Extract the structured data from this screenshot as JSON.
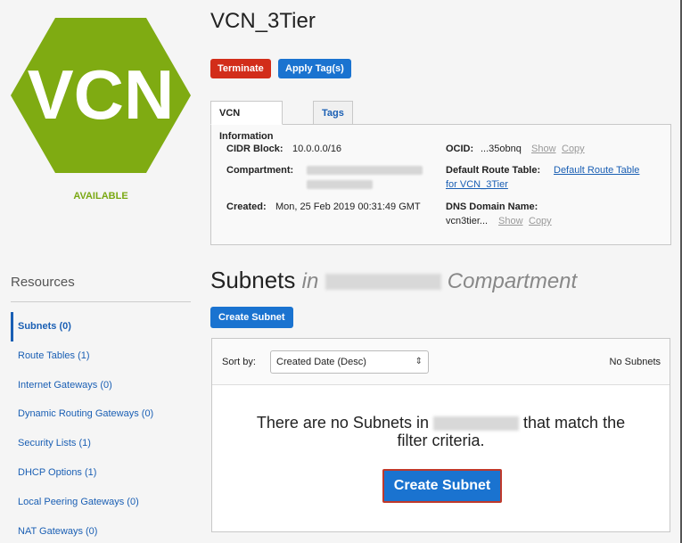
{
  "vcn": {
    "badge_text": "VCN",
    "status": "AVAILABLE",
    "title": "VCN_3Tier"
  },
  "actions": {
    "terminate": "Terminate",
    "apply_tags": "Apply Tag(s)"
  },
  "tabs": [
    {
      "label": "VCN Information"
    },
    {
      "label": "Tags"
    }
  ],
  "info": {
    "cidr_label": "CIDR Block:",
    "cidr_value": "10.0.0.0/16",
    "compartment_label": "Compartment:",
    "created_label": "Created:",
    "created_value": "Mon, 25 Feb 2019 00:31:49 GMT",
    "ocid_label": "OCID:",
    "ocid_value": "...35obnq",
    "show": "Show",
    "copy": "Copy",
    "route_table_label": "Default Route Table:",
    "route_table_value_1": "Default Route Table",
    "route_table_value_2": "for VCN_3Tier",
    "dns_label": "DNS Domain Name:",
    "dns_value": "vcn3tier..."
  },
  "resources": {
    "heading": "Resources",
    "items": [
      {
        "label": "Subnets (0)"
      },
      {
        "label": "Route Tables (1)"
      },
      {
        "label": "Internet Gateways (0)"
      },
      {
        "label": "Dynamic Routing Gateways (0)"
      },
      {
        "label": "Security Lists (1)"
      },
      {
        "label": "DHCP Options (1)"
      },
      {
        "label": "Local Peering Gateways (0)"
      },
      {
        "label": "NAT Gateways (0)"
      }
    ]
  },
  "subnets": {
    "heading": "Subnets",
    "in_word": "in",
    "compartment_word": "Compartment",
    "create_label": "Create Subnet",
    "sort_label": "Sort by:",
    "sort_value": "Created Date (Desc)",
    "count_text": "No Subnets",
    "empty_part1": "There are no Subnets in",
    "empty_part2": "that match the",
    "empty_line2": "filter criteria.",
    "create_big_label": "Create Subnet"
  },
  "colors": {
    "hex_green": "#7fab12",
    "primary_blue": "#1a73d0",
    "danger_red": "#d22d1a"
  }
}
